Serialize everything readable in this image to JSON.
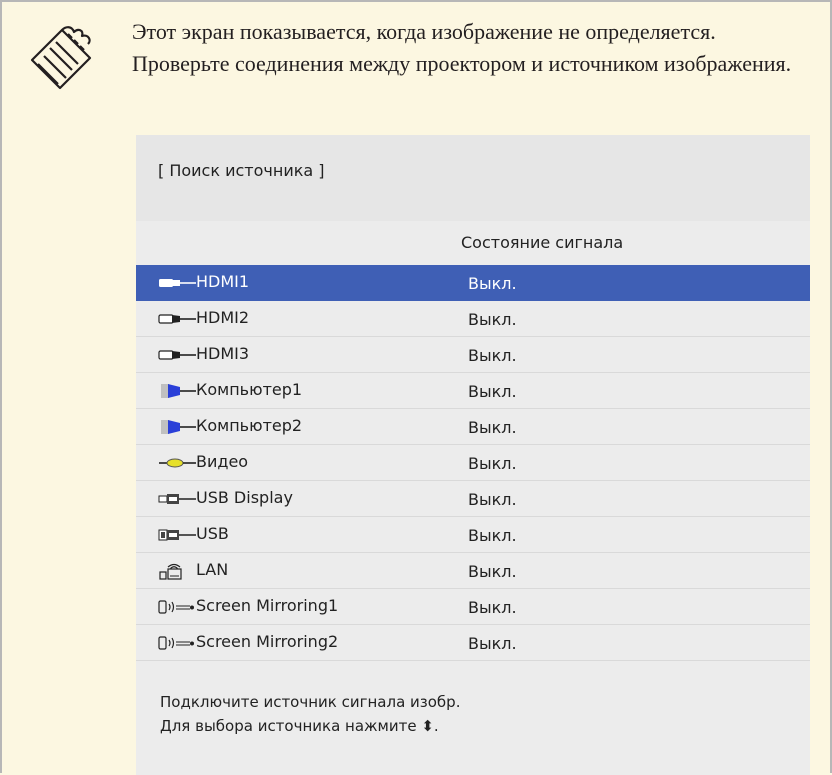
{
  "note": {
    "icon": "note-icon",
    "text": "Этот экран показывается, когда изображение не определяется. Проверьте соединения между проектором и источником изображения."
  },
  "panel": {
    "title": "[ Поиск источника ]",
    "column_status": "Состояние сигнала",
    "sources": [
      {
        "name": "HDMI1",
        "status": "Выкл.",
        "icon": "hdmi-icon",
        "selected": true
      },
      {
        "name": "HDMI2",
        "status": "Выкл.",
        "icon": "hdmi-icon",
        "selected": false
      },
      {
        "name": "HDMI3",
        "status": "Выкл.",
        "icon": "hdmi-icon",
        "selected": false
      },
      {
        "name": "Компьютер1",
        "status": "Выкл.",
        "icon": "computer-vga-icon",
        "selected": false
      },
      {
        "name": "Компьютер2",
        "status": "Выкл.",
        "icon": "computer-vga-icon",
        "selected": false
      },
      {
        "name": "Видео",
        "status": "Выкл.",
        "icon": "video-rca-icon",
        "selected": false
      },
      {
        "name": "USB Display",
        "status": "Выкл.",
        "icon": "usb-display-icon",
        "selected": false
      },
      {
        "name": "USB",
        "status": "Выкл.",
        "icon": "usb-icon",
        "selected": false
      },
      {
        "name": "LAN",
        "status": "Выкл.",
        "icon": "lan-icon",
        "selected": false
      },
      {
        "name": "Screen Mirroring1",
        "status": "Выкл.",
        "icon": "screen-mirroring-icon",
        "selected": false
      },
      {
        "name": "Screen Mirroring2",
        "status": "Выкл.",
        "icon": "screen-mirroring-icon",
        "selected": false
      }
    ],
    "footer_line1": "Подключите источник сигнала изобр.",
    "footer_line2": "Для выбора источника нажмите ⬍."
  },
  "colors": {
    "selected_row": "#3f5fb5",
    "note_background": "#fcf7e1",
    "panel_background": "#ececec",
    "vga_blue": "#2a3fd8",
    "rca_yellow": "#e6e02a"
  }
}
